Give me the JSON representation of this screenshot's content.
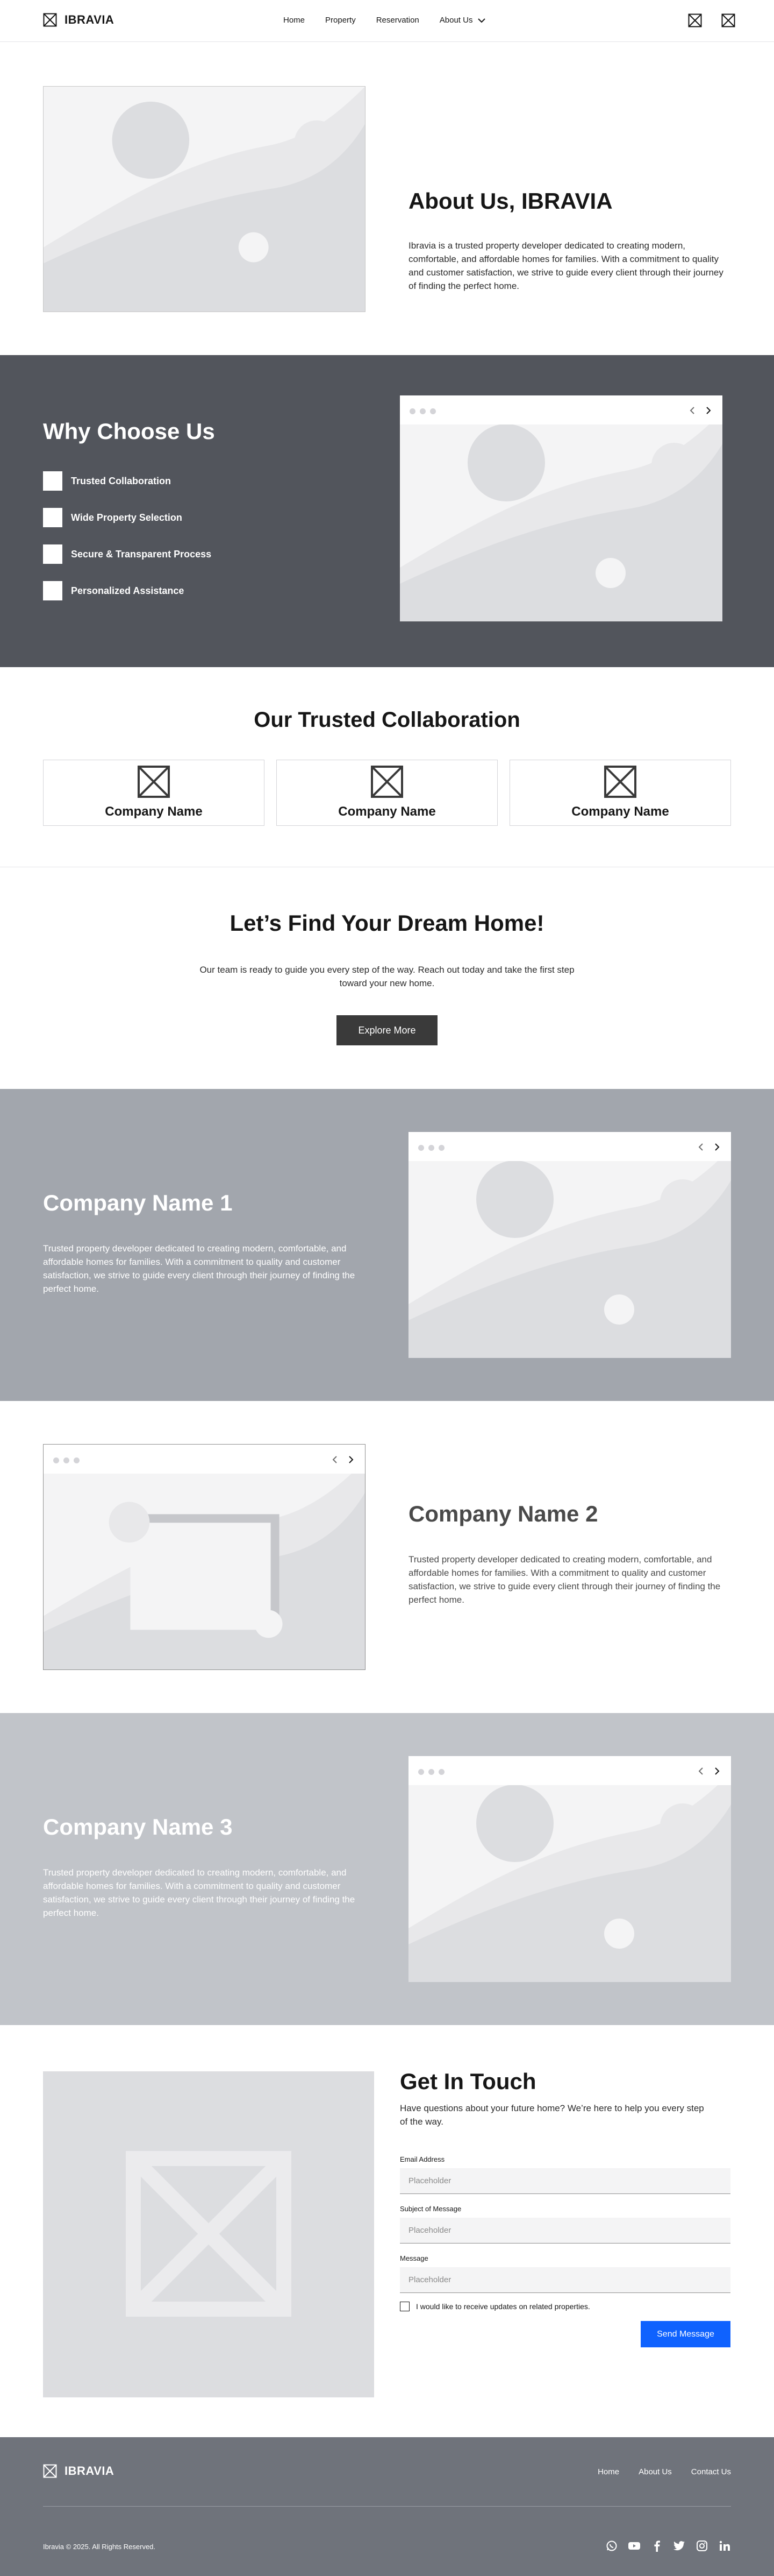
{
  "header": {
    "brand": "IBRAVIA",
    "nav": [
      {
        "label": "Home"
      },
      {
        "label": "Property"
      },
      {
        "label": "Reservation"
      },
      {
        "label": "About Us"
      }
    ]
  },
  "about": {
    "title": "About Us, IBRAVIA",
    "text": "Ibravia is a trusted property developer dedicated to creating modern, comfortable, and affordable homes for families. With a commitment to quality and customer satisfaction, we strive to guide every client through their journey of finding the perfect home."
  },
  "why": {
    "title": "Why Choose Us",
    "items": [
      {
        "label": "Trusted Collaboration"
      },
      {
        "label": "Wide Property Selection"
      },
      {
        "label": "Secure & Transparent Process"
      },
      {
        "label": "Personalized Assistance"
      }
    ]
  },
  "collab": {
    "title": "Our Trusted Collaboration",
    "cards": [
      {
        "name": "Company Name"
      },
      {
        "name": "Company Name"
      },
      {
        "name": "Company Name"
      }
    ]
  },
  "dream": {
    "title": "Let’s Find Your Dream Home!",
    "text": "Our team is ready to guide you every step of the way. Reach out today and take the first step toward your new home.",
    "button": "Explore More"
  },
  "companies": [
    {
      "name": "Company Name 1",
      "text": "Trusted property developer dedicated to creating modern, comfortable, and affordable homes for families. With a commitment to quality and customer satisfaction, we strive to guide every client through their journey of finding the perfect home."
    },
    {
      "name": "Company Name 2",
      "text": "Trusted property developer dedicated to creating modern, comfortable, and affordable homes for families. With a commitment to quality and customer satisfaction, we strive to guide every client through their journey of finding the perfect home."
    },
    {
      "name": "Company Name 3",
      "text": "Trusted property developer dedicated to creating modern, comfortable, and affordable homes for families. With a commitment to quality and customer satisfaction, we strive to guide every client through their journey of finding the perfect home."
    }
  ],
  "contact": {
    "title": "Get In Touch",
    "subtitle": "Have questions about your future home? We’re here to help you every step of the way.",
    "fields": [
      {
        "label": "Email Address",
        "placeholder": "Placeholder"
      },
      {
        "label": "Subject of Message",
        "placeholder": "Placeholder"
      },
      {
        "label": "Message",
        "placeholder": "Placeholder"
      }
    ],
    "checkbox": "I would like to receive updates on related properties.",
    "button": "Send Message"
  },
  "footer": {
    "brand": "IBRAVIA",
    "links": [
      {
        "label": "Home"
      },
      {
        "label": "About Us"
      },
      {
        "label": "Contact Us"
      }
    ],
    "copyright": "Ibravia © 2025. All Rights Reserved.",
    "socials": [
      "whatsapp-icon",
      "youtube-icon",
      "facebook-icon",
      "twitter-icon",
      "instagram-icon",
      "linkedin-icon"
    ]
  },
  "colors": {
    "dark_section": "#52555c",
    "company1_bg": "#a2a6ad",
    "company3_bg": "#c1c4c9",
    "footer_bg": "#6f737b",
    "primary_button": "#0f62fe",
    "dark_button": "#3a3a3a"
  }
}
